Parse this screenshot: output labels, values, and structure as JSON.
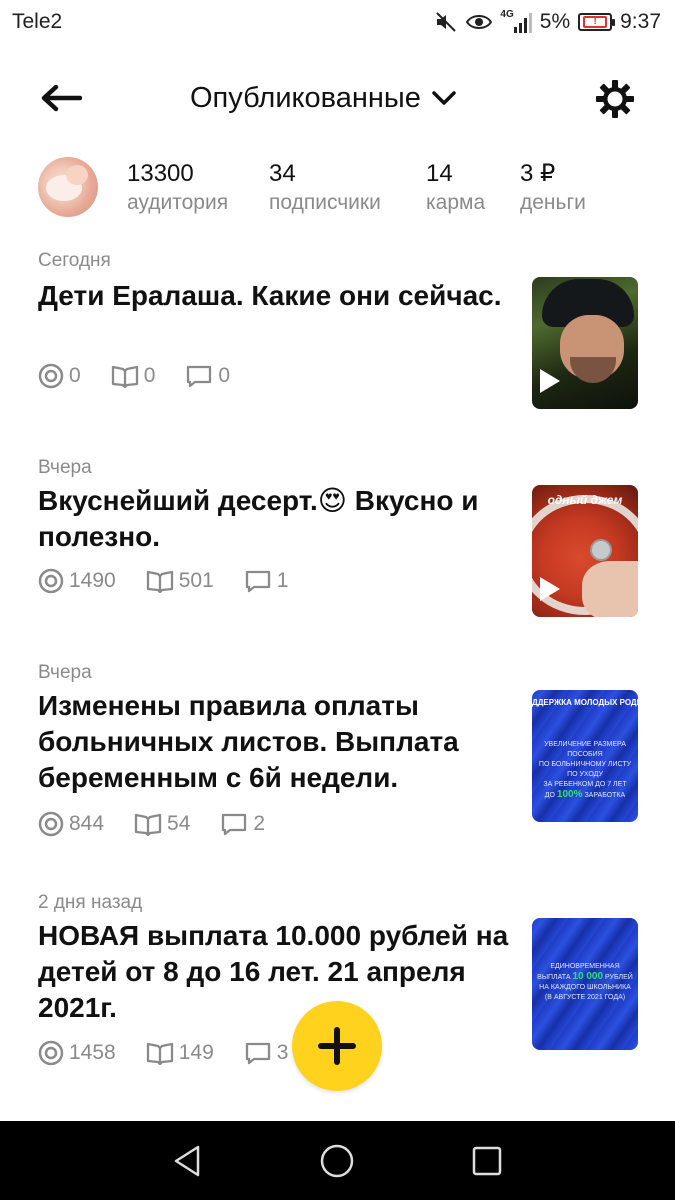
{
  "status_bar": {
    "carrier": "Tele2",
    "network": "4G",
    "battery_percent": "5%",
    "time": "9:37",
    "icons": [
      "mute-icon",
      "eye-icon",
      "signal-icon",
      "battery-icon"
    ]
  },
  "header": {
    "title": "Опубликованные",
    "back_icon": "arrow-left-icon",
    "dropdown_icon": "chevron-down-icon",
    "settings_icon": "gear-icon"
  },
  "stats": [
    {
      "value": "13300",
      "label": "аудитория"
    },
    {
      "value": "34",
      "label": "подписчики"
    },
    {
      "value": "14",
      "label": "карма"
    },
    {
      "value": "3 ₽",
      "label": "деньги"
    }
  ],
  "posts": [
    {
      "date": "Сегодня",
      "title": "Дети Ералаша. Какие они сейчас.",
      "views": "0",
      "reads": "0",
      "comments": "0",
      "has_video": true
    },
    {
      "date": "Вчера",
      "title": "Вкуснейший десерт.😍 Вкусно и полезно.",
      "views": "1490",
      "reads": "501",
      "comments": "1",
      "has_video": true,
      "thumb_caption": "одный джем"
    },
    {
      "date": "Вчера",
      "title": "Изменены правила оплаты больничных листов. Выплата беременным с 6й недели.",
      "views": "844",
      "reads": "54",
      "comments": "2",
      "has_video": false,
      "thumb_heading": "ДДЕРЖКА МОЛОДЫХ РОДИТЕ",
      "thumb_lines": [
        "УВЕЛИЧЕНИЕ РАЗМЕРА ПОСОБИЯ",
        "ПО БОЛЬНИЧНОМУ ЛИСТУ ПО УХОДУ",
        "ЗА РЕБЕНКОМ ДО 7 ЛЕТ",
        "ДО",
        "100%",
        "ЗАРАБОТКА"
      ]
    },
    {
      "date": "2 дня назад",
      "title": "НОВАЯ выплата 10.000 рублей на детей от 8 до 16 лет. 21 апреля 2021г.",
      "views": "1458",
      "reads": "149",
      "comments": "3",
      "has_video": false,
      "thumb_lines": [
        "ЕДИНОВРЕМЕННАЯ ВЫПЛАТА",
        "10 000",
        "РУБЛЕЙ",
        "НА КАЖДОГО ШКОЛЬНИКА",
        "(В АВГУСТЕ 2021 ГОДА)"
      ]
    }
  ],
  "fab_icon": "plus-icon",
  "nav": [
    "back-triangle-icon",
    "home-circle-icon",
    "recents-square-icon"
  ]
}
